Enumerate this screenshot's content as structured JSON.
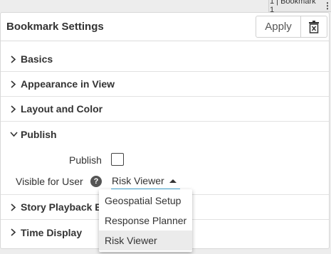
{
  "top_tag": {
    "label": "1 | Bookmark 1",
    "menu_glyph": "⋮"
  },
  "header": {
    "title": "Bookmark Settings",
    "apply_label": "Apply",
    "delete_icon": "trash-icon"
  },
  "sections": [
    {
      "label": "Basics",
      "expanded": false
    },
    {
      "label": "Appearance in View",
      "expanded": false
    },
    {
      "label": "Layout and Color",
      "expanded": false
    },
    {
      "label": "Publish",
      "expanded": true
    },
    {
      "label": "Story Playback Behavior",
      "expanded": false
    },
    {
      "label": "Time Display",
      "expanded": false
    }
  ],
  "publish": {
    "publish_label": "Publish",
    "publish_checked": false,
    "visible_label": "Visible for User",
    "help_glyph": "?",
    "selected_user": "Risk Viewer",
    "options": [
      "Geospatial Setup",
      "Response Planner",
      "Risk Viewer"
    ]
  },
  "colors": {
    "accent": "#3fa7d6",
    "text": "#333333",
    "border": "#d0d0d0"
  }
}
